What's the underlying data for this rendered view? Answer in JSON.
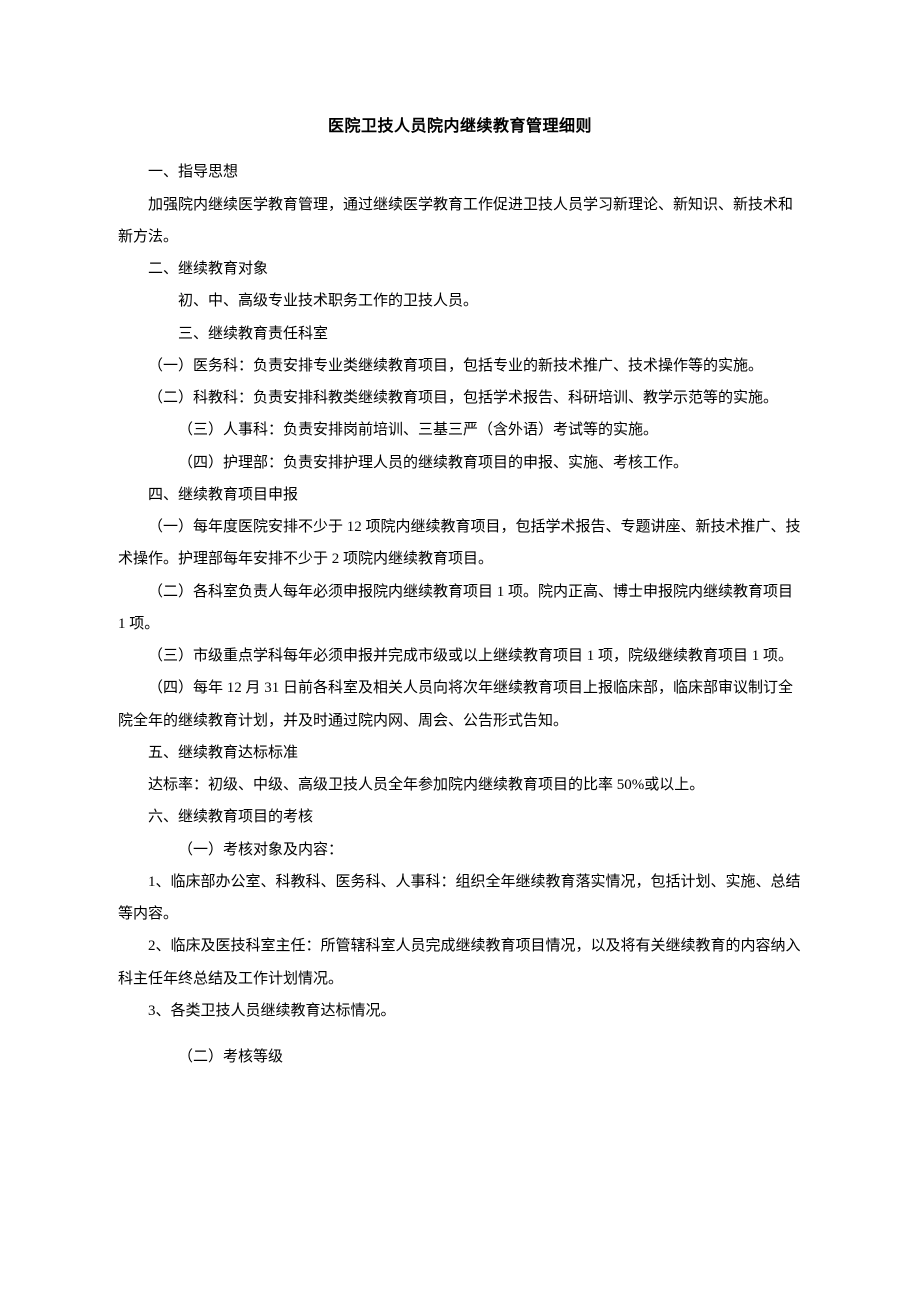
{
  "title": "医院卫技人员院内继续教育管理细则",
  "p1": "一、指导思想",
  "p2": "加强院内继续医学教育管理，通过继续医学教育工作促进卫技人员学习新理论、新知识、新技术和新方法。",
  "p3": "二、继续教育对象",
  "p4": "初、中、高级专业技术职务工作的卫技人员。",
  "p5": "三、继续教育责任科室",
  "p6": "（一）医务科：负责安排专业类继续教育项目，包括专业的新技术推广、技术操作等的实施。",
  "p7": "（二）科教科：负责安排科教类继续教育项目，包括学术报告、科研培训、教学示范等的实施。",
  "p8": "（三）人事科：负责安排岗前培训、三基三严（含外语）考试等的实施。",
  "p9": "（四）护理部：负责安排护理人员的继续教育项目的申报、实施、考核工作。",
  "p10": "四、继续教育项目申报",
  "p11": "（一）每年度医院安排不少于 12 项院内继续教育项目，包括学术报告、专题讲座、新技术推广、技术操作。护理部每年安排不少于 2 项院内继续教育项目。",
  "p12": "（二）各科室负责人每年必须申报院内继续教育项目 1 项。院内正高、博士申报院内继续教育项目 1 项。",
  "p13": "（三）市级重点学科每年必须申报并完成市级或以上继续教育项目 1 项，院级继续教育项目 1 项。",
  "p14": "（四）每年 12 月 31 日前各科室及相关人员向将次年继续教育项目上报临床部，临床部审议制订全院全年的继续教育计划，并及时通过院内网、周会、公告形式告知。",
  "p15": "五、继续教育达标标准",
  "p16": "达标率：初级、中级、高级卫技人员全年参加院内继续教育项目的比率 50%或以上。",
  "p17": "六、继续教育项目的考核",
  "p18": "（一）考核对象及内容：",
  "p19": "1、临床部办公室、科教科、医务科、人事科：组织全年继续教育落实情况，包括计划、实施、总结等内容。",
  "p20": "2、临床及医技科室主任：所管辖科室人员完成继续教育项目情况，以及将有关继续教育的内容纳入科主任年终总结及工作计划情况。",
  "p21": "3、各类卫技人员继续教育达标情况。",
  "p22": "（二）考核等级"
}
